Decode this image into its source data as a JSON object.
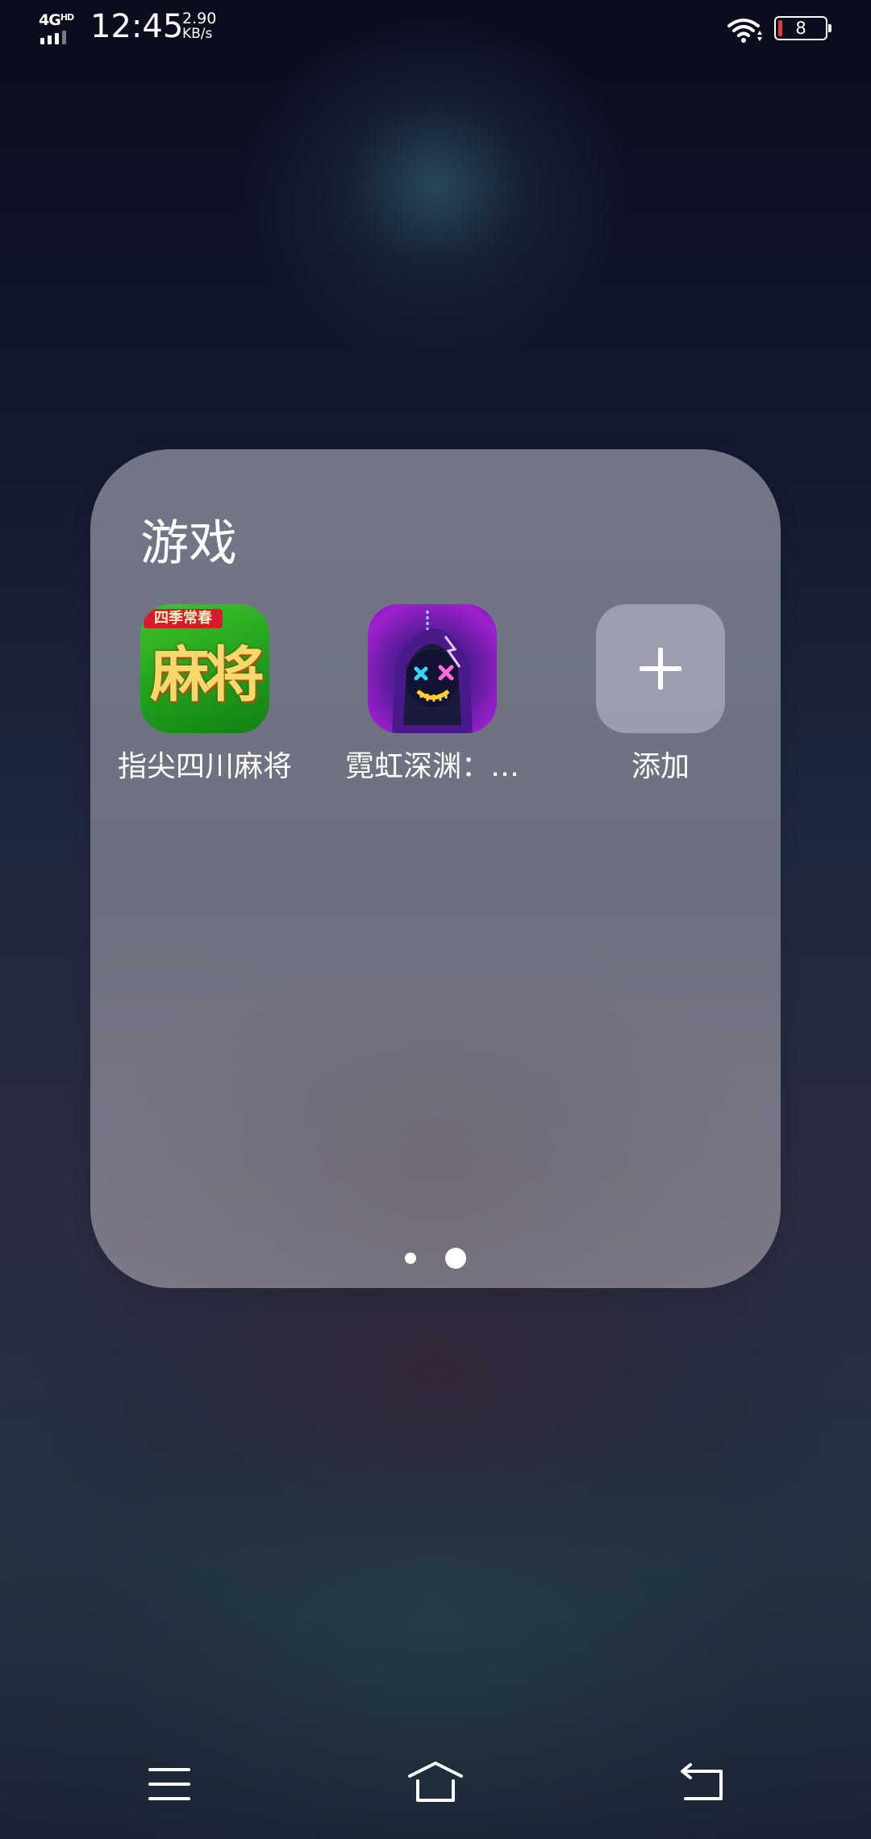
{
  "status_bar": {
    "network": "4G",
    "network_sup": "HD",
    "time": "12:45",
    "speed_value": "2.90",
    "speed_unit": "KB/s",
    "battery_level": "8",
    "icons": [
      "signal-icon",
      "wifi-icon",
      "battery-icon"
    ]
  },
  "folder": {
    "title": "游戏",
    "apps": [
      {
        "label": "指尖四川麻将",
        "icon": "mahjong-app-icon",
        "badge_text": "四季常春",
        "icon_text": "麻将"
      },
      {
        "label": "霓虹深渊：…",
        "icon": "neon-abyss-app-icon"
      },
      {
        "label": "添加",
        "icon": "plus-icon"
      }
    ],
    "pages": 2,
    "current_page": 2
  },
  "nav_bar": {
    "buttons": [
      "menu-icon",
      "home-icon",
      "back-icon"
    ]
  },
  "colors": {
    "battery_low": "#e53935",
    "mahjong_green": "#1e9c1a",
    "neon_purple": "#a020d0"
  }
}
